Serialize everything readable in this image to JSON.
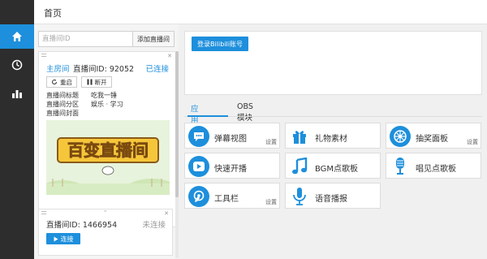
{
  "header": {
    "title": "首页"
  },
  "left": {
    "search_placeholder": "直播间ID",
    "add_button": "添加直播间",
    "room1": {
      "type_label": "主房间",
      "id_label": "直播间ID: 92052",
      "status": "已连接",
      "restart": "重启",
      "disconnect": "断开",
      "info": [
        {
          "label": "直播间标题",
          "value": "吃我一锤"
        },
        {
          "label": "直播间分区",
          "value": "娱乐 · 学习"
        },
        {
          "label": "直播间封面",
          "value": ""
        }
      ],
      "cover_text": "百变直播间"
    },
    "room2": {
      "id_label": "直播间ID: 1466954",
      "status": "未连接",
      "connect": "连接"
    }
  },
  "login": {
    "button": "登录Bilibili账号"
  },
  "tabs": [
    {
      "label": "应用模块",
      "active": true
    },
    {
      "label": "OBS模块",
      "active": false
    }
  ],
  "modules": [
    {
      "label": "弹幕视图",
      "icon": "chat-bubble-icon",
      "setting": "设置"
    },
    {
      "label": "礼物素材",
      "icon": "gift-icon",
      "setting": ""
    },
    {
      "label": "抽奖面板",
      "icon": "wheel-icon",
      "setting": "设置"
    },
    {
      "label": "快速开播",
      "icon": "play-icon",
      "setting": ""
    },
    {
      "label": "BGM点歌板",
      "icon": "music-note-icon",
      "setting": ""
    },
    {
      "label": "唱见点歌板",
      "icon": "microphone-icon",
      "setting": ""
    },
    {
      "label": "工具栏",
      "icon": "toolbar-icon",
      "setting": "设置"
    },
    {
      "label": "语音播报",
      "icon": "voice-icon",
      "setting": ""
    }
  ],
  "colors": {
    "accent": "#1d8fdc",
    "sidebar": "#2d2d2d"
  }
}
